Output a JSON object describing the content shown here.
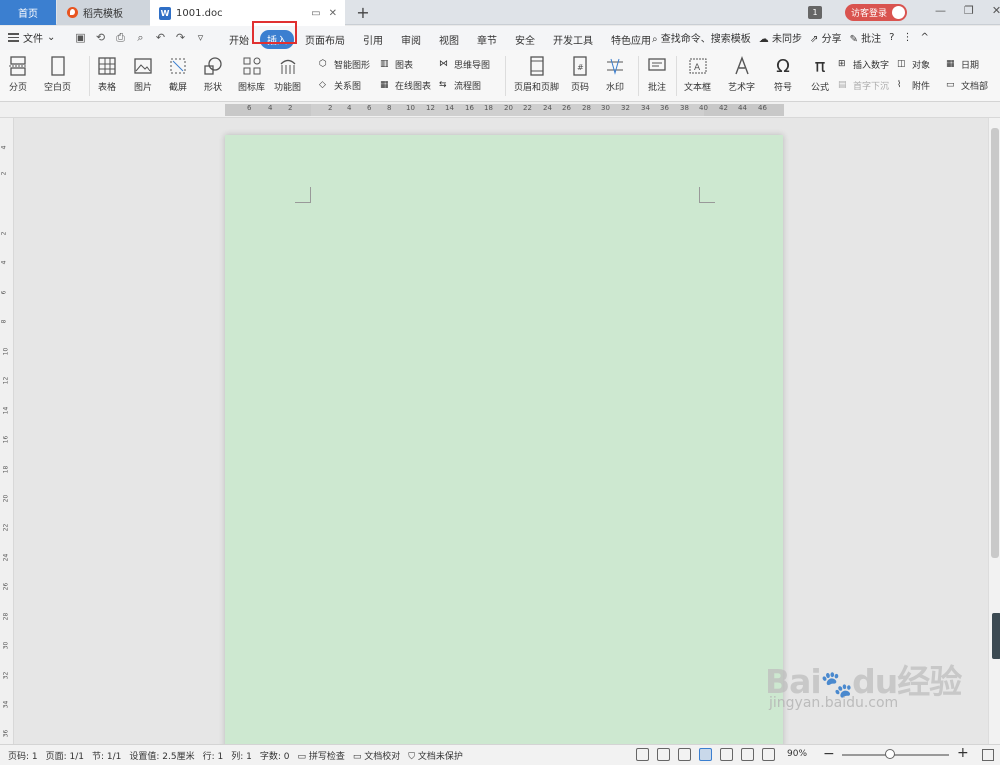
{
  "tabs": {
    "home": "首页",
    "templates": "稻壳模板",
    "doc": "1001.doc",
    "add": "+"
  },
  "titlebar": {
    "badge": "1",
    "login": "访客登录",
    "minimize": "—",
    "restore": "❐",
    "close": "✕"
  },
  "menu": {
    "file": "文件",
    "tabs": [
      "开始",
      "插入",
      "页面布局",
      "引用",
      "审阅",
      "视图",
      "章节",
      "安全",
      "开发工具",
      "特色应用"
    ],
    "active_tab": "插入",
    "search": "查找命令、搜索模板",
    "sync": "未同步",
    "share": "分享",
    "comment": "批注",
    "help": "?",
    "more": "⋮",
    "collapse": "^"
  },
  "ribbon": {
    "page_break": "分页",
    "blank_page": "空白页",
    "table": "表格",
    "picture": "图片",
    "screenshot": "截屏",
    "shapes": "形状",
    "icon_lib": "图标库",
    "function_chart": "功能图",
    "smart_art": "智能图形",
    "chart": "图表",
    "mind_map": "思维导图",
    "relation_map": "关系图",
    "online_chart": "在线图表",
    "flowchart": "流程图",
    "header_footer": "页眉和页脚",
    "page_number": "页码",
    "watermark": "水印",
    "comment": "批注",
    "textbox": "文本框",
    "wordart": "艺术字",
    "symbol": "符号",
    "formula": "公式",
    "insert_number": "插入数字",
    "drop_cap": "首字下沉",
    "object": "对象",
    "attachment": "附件",
    "date": "日期",
    "doc_part": "文档部"
  },
  "ruler": {
    "h_ticks": [
      "6",
      "4",
      "2",
      "2",
      "4",
      "6",
      "8",
      "10",
      "12",
      "14",
      "16",
      "18",
      "20",
      "22",
      "24",
      "26",
      "28",
      "30",
      "32",
      "34",
      "36",
      "38",
      "40",
      "42",
      "44",
      "46"
    ],
    "v_ticks": [
      "4",
      "2",
      "2",
      "4",
      "6",
      "8",
      "10",
      "12",
      "14",
      "16",
      "18",
      "20",
      "22",
      "24",
      "26",
      "28",
      "30",
      "32",
      "34",
      "36"
    ]
  },
  "watermark": {
    "brand": "Bai",
    "brand2": "经验",
    "url": "jingyan.baidu.com"
  },
  "status": {
    "page_code": "页码: 1",
    "page": "页面: 1/1",
    "section": "节: 1/1",
    "setting": "设置值: 2.5厘米",
    "row": "行: 1",
    "col": "列: 1",
    "words": "字数: 0",
    "spell": "拼写检查",
    "proof": "文档校对",
    "protect": "文档未保护",
    "zoom": "90%",
    "zoom_minus": "−",
    "zoom_plus": "+"
  },
  "colors": {
    "accent": "#3b7fd0",
    "page_bg": "#cde8d0",
    "highlight": "#e03030",
    "login": "#d9534f"
  }
}
